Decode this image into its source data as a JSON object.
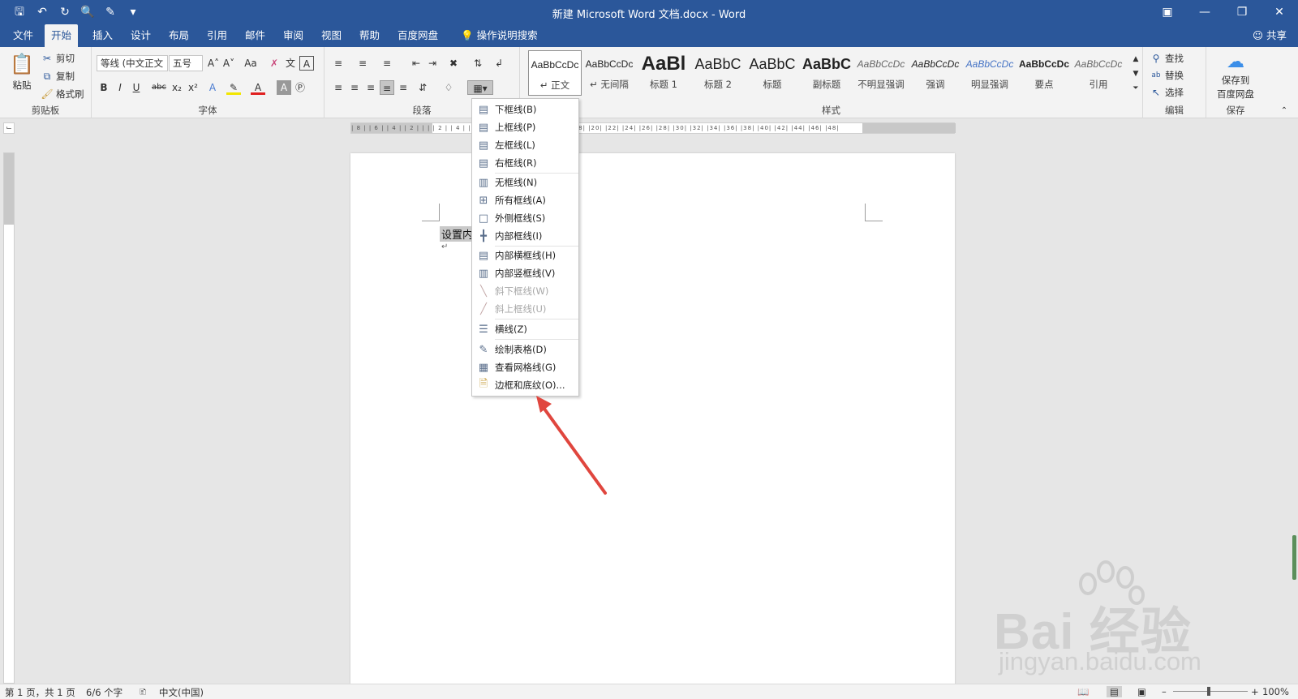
{
  "window": {
    "title": "新建 Microsoft Word 文档.docx  -  Word",
    "quick_access": [
      "save-icon",
      "undo-icon",
      "redo-icon",
      "print-preview-icon",
      "clipboard-icon",
      "customize-icon"
    ],
    "controls": [
      "ribbon-display-icon",
      "minimize-icon",
      "restore-icon",
      "close-icon"
    ]
  },
  "tabs": {
    "items": [
      "文件",
      "开始",
      "插入",
      "设计",
      "布局",
      "引用",
      "邮件",
      "审阅",
      "视图",
      "帮助",
      "百度网盘"
    ],
    "active": "开始",
    "tell_me": "操作说明搜索",
    "share": "共享"
  },
  "ribbon": {
    "clipboard": {
      "label": "剪贴板",
      "paste": "粘贴",
      "cut": "剪切",
      "copy": "复制",
      "format_painter": "格式刷"
    },
    "font": {
      "label": "字体",
      "font_name": "等线 (中文正文",
      "font_size": "五号"
    },
    "paragraph": {
      "label": "段落"
    },
    "styles": {
      "label": "样式",
      "items": [
        {
          "preview": "AaBbCcDc",
          "name": "↵ 正文"
        },
        {
          "preview": "AaBbCcDc",
          "name": "↵ 无间隔"
        },
        {
          "preview": "AaBl",
          "name": "标题 1"
        },
        {
          "preview": "AaBbC",
          "name": "标题 2"
        },
        {
          "preview": "AaBbC",
          "name": "标题"
        },
        {
          "preview": "AaBbC",
          "name": "副标题"
        },
        {
          "preview": "AaBbCcDc",
          "name": "不明显强调"
        },
        {
          "preview": "AaBbCcDc",
          "name": "强调"
        },
        {
          "preview": "AaBbCcDc",
          "name": "明显强调"
        },
        {
          "preview": "AaBbCcDc",
          "name": "要点"
        },
        {
          "preview": "AaBbCcDc",
          "name": "引用"
        }
      ]
    },
    "editing": {
      "label": "编辑",
      "find": "查找",
      "replace": "替换",
      "select": "选择"
    },
    "save": {
      "label": "保存",
      "button_line1": "保存到",
      "button_line2": "百度网盘"
    }
  },
  "document": {
    "text": "设置内",
    "paragraph_mark": "↵"
  },
  "border_menu": {
    "items": [
      {
        "label": "下框线(B)",
        "icon": "bottom-border-icon",
        "disabled": false
      },
      {
        "label": "上框线(P)",
        "icon": "top-border-icon",
        "disabled": false
      },
      {
        "label": "左框线(L)",
        "icon": "left-border-icon",
        "disabled": false
      },
      {
        "label": "右框线(R)",
        "icon": "right-border-icon",
        "disabled": false
      },
      {
        "label": "无框线(N)",
        "icon": "no-border-icon",
        "disabled": false
      },
      {
        "label": "所有框线(A)",
        "icon": "all-borders-icon",
        "disabled": false
      },
      {
        "label": "外侧框线(S)",
        "icon": "outside-borders-icon",
        "disabled": false
      },
      {
        "label": "内部框线(I)",
        "icon": "inside-borders-icon",
        "disabled": false
      },
      {
        "label": "内部横框线(H)",
        "icon": "inside-horizontal-border-icon",
        "disabled": false
      },
      {
        "label": "内部竖框线(V)",
        "icon": "inside-vertical-border-icon",
        "disabled": false
      },
      {
        "label": "斜下框线(W)",
        "icon": "diagonal-down-border-icon",
        "disabled": true
      },
      {
        "label": "斜上框线(U)",
        "icon": "diagonal-up-border-icon",
        "disabled": true
      },
      {
        "label": "横线(Z)",
        "icon": "horizontal-line-icon",
        "disabled": false
      },
      {
        "label": "绘制表格(D)",
        "icon": "draw-table-icon",
        "disabled": false
      },
      {
        "label": "查看网格线(G)",
        "icon": "view-gridlines-icon",
        "disabled": false
      },
      {
        "label": "边框和底纹(O)...",
        "icon": "borders-shading-icon",
        "disabled": false
      }
    ]
  },
  "status": {
    "page": "第 1 页，共 1 页",
    "words": "6/6 个字",
    "language": "中文(中国)",
    "zoom": "100%"
  },
  "watermark": {
    "main": "Bai 经验",
    "sub": "jingyan.baidu.com"
  },
  "colors": {
    "brand": "#2b579a",
    "arrow": "#e0463e",
    "ribbon_bg": "#f3f3f3",
    "canvas_bg": "#e6e6e6"
  }
}
